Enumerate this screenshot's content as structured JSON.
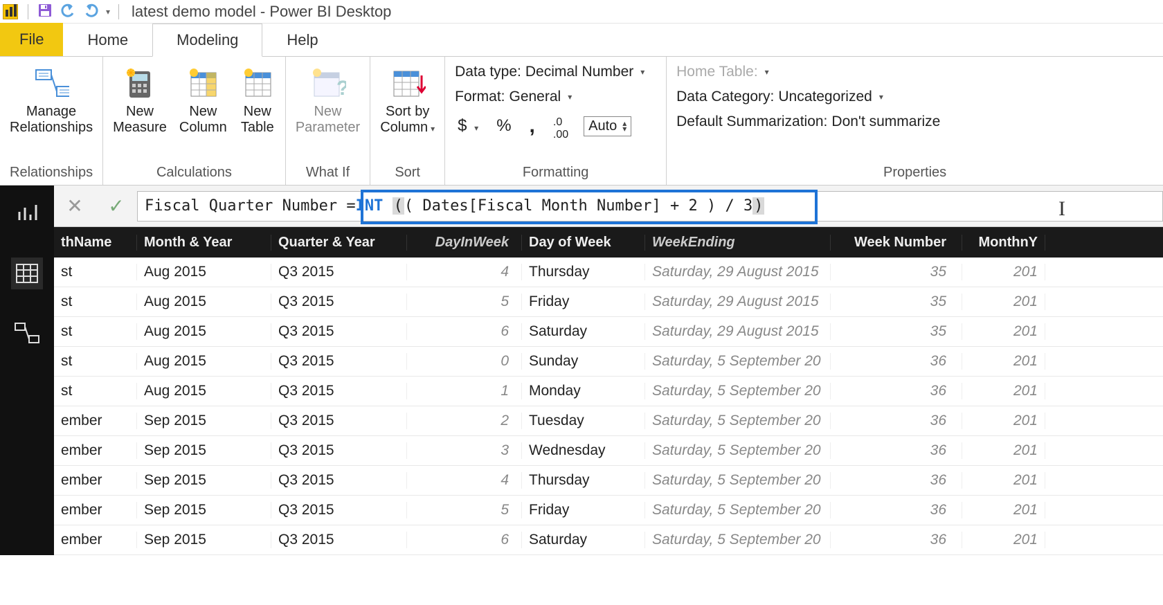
{
  "title": "latest demo model - Power BI Desktop",
  "menu": {
    "file": "File",
    "home": "Home",
    "modeling": "Modeling",
    "help": "Help",
    "active": "Modeling"
  },
  "ribbon": {
    "relationships": {
      "manage": "Manage\nRelationships",
      "group": "Relationships"
    },
    "calculations": {
      "measure": "New\nMeasure",
      "column": "New\nColumn",
      "table": "New\nTable",
      "group": "Calculations"
    },
    "whatif": {
      "param": "New\nParameter",
      "group": "What If"
    },
    "sort": {
      "sortby": "Sort by\nColumn",
      "group": "Sort"
    },
    "formatting": {
      "datatype_label": "Data type:",
      "datatype_value": "Decimal Number",
      "format_label": "Format:",
      "format_value": "General",
      "currency": "$",
      "percent": "%",
      "thousands": ",",
      "decimals": ".00",
      "auto": "Auto",
      "group": "Formatting"
    },
    "properties": {
      "home_table_label": "Home Table:",
      "category_label": "Data Category:",
      "category_value": "Uncategorized",
      "summ_label": "Default Summarization:",
      "summ_value": "Don't summarize",
      "group": "Properties"
    }
  },
  "formula": {
    "left": "Fiscal Quarter Number = ",
    "kw": "INT",
    "mid": " ( Dates[Fiscal Month Number] + 2 ) / 3 ",
    "open": "(",
    "close": ")"
  },
  "grid": {
    "headers": {
      "thName": "thName",
      "monthYear": "Month & Year",
      "qy": "Quarter & Year",
      "diw": "DayInWeek",
      "dow": "Day of Week",
      "wend": "WeekEnding",
      "wn": "Week Number",
      "mny": "MonthnY"
    },
    "rows": [
      {
        "thName": "st",
        "monthYear": "Aug 2015",
        "qy": "Q3 2015",
        "diw": "4",
        "dow": "Thursday",
        "wend": "Saturday, 29 August 2015",
        "wn": "35",
        "mny": "201"
      },
      {
        "thName": "st",
        "monthYear": "Aug 2015",
        "qy": "Q3 2015",
        "diw": "5",
        "dow": "Friday",
        "wend": "Saturday, 29 August 2015",
        "wn": "35",
        "mny": "201"
      },
      {
        "thName": "st",
        "monthYear": "Aug 2015",
        "qy": "Q3 2015",
        "diw": "6",
        "dow": "Saturday",
        "wend": "Saturday, 29 August 2015",
        "wn": "35",
        "mny": "201"
      },
      {
        "thName": "st",
        "monthYear": "Aug 2015",
        "qy": "Q3 2015",
        "diw": "0",
        "dow": "Sunday",
        "wend": "Saturday, 5 September 20",
        "wn": "36",
        "mny": "201"
      },
      {
        "thName": "st",
        "monthYear": "Aug 2015",
        "qy": "Q3 2015",
        "diw": "1",
        "dow": "Monday",
        "wend": "Saturday, 5 September 20",
        "wn": "36",
        "mny": "201"
      },
      {
        "thName": "ember",
        "monthYear": "Sep 2015",
        "qy": "Q3 2015",
        "diw": "2",
        "dow": "Tuesday",
        "wend": "Saturday, 5 September 20",
        "wn": "36",
        "mny": "201"
      },
      {
        "thName": "ember",
        "monthYear": "Sep 2015",
        "qy": "Q3 2015",
        "diw": "3",
        "dow": "Wednesday",
        "wend": "Saturday, 5 September 20",
        "wn": "36",
        "mny": "201"
      },
      {
        "thName": "ember",
        "monthYear": "Sep 2015",
        "qy": "Q3 2015",
        "diw": "4",
        "dow": "Thursday",
        "wend": "Saturday, 5 September 20",
        "wn": "36",
        "mny": "201"
      },
      {
        "thName": "ember",
        "monthYear": "Sep 2015",
        "qy": "Q3 2015",
        "diw": "5",
        "dow": "Friday",
        "wend": "Saturday, 5 September 20",
        "wn": "36",
        "mny": "201"
      },
      {
        "thName": "ember",
        "monthYear": "Sep 2015",
        "qy": "Q3 2015",
        "diw": "6",
        "dow": "Saturday",
        "wend": "Saturday, 5 September 20",
        "wn": "36",
        "mny": "201"
      }
    ]
  }
}
